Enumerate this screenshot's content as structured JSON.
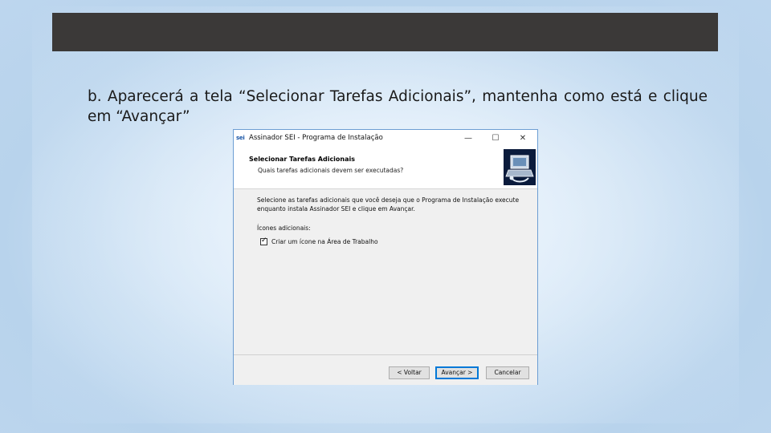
{
  "slide": {
    "instruction_text": "b. Aparecerá a tela “Selecionar Tarefas Adicionais”, mantenha como está e clique em “Avançar”"
  },
  "dialog": {
    "app_icon_text": "sei",
    "title": "Assinador SEI - Programa de Instalação",
    "window_controls": {
      "minimize": "—",
      "maximize": "☐",
      "close": "✕"
    },
    "header": {
      "title": "Selecionar Tarefas Adicionais",
      "subtitle": "Quais tarefas adicionais devem ser executadas?"
    },
    "body": {
      "description": "Selecione as tarefas adicionais que você deseja que o Programa de Instalação execute enquanto instala Assinador SEI e clique em Avançar.",
      "icons_label": "Ícones adicionais:",
      "checkbox_label": "Criar um ícone na Área de Trabalho",
      "checkbox_checked": true,
      "checkbox_tick": "✓"
    },
    "buttons": {
      "back": "< Voltar",
      "next": "Avançar >",
      "cancel": "Cancelar"
    },
    "colors": {
      "accent": "#0078d7",
      "border": "#6d9ed3",
      "title_bar": "#3b3938"
    }
  }
}
